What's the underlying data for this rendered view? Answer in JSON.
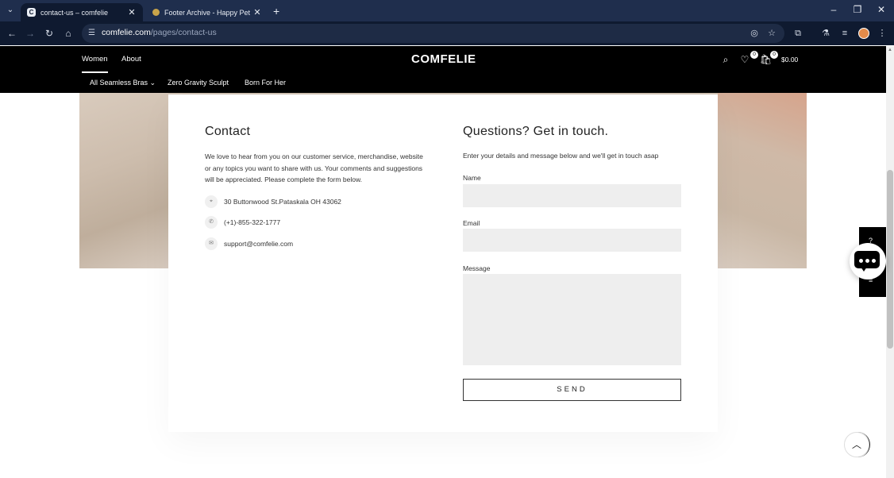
{
  "browser": {
    "tabs": [
      {
        "title": "contact-us – comfelie",
        "favicon": "C",
        "active": true
      },
      {
        "title": "Footer Archive - Happy Pet",
        "favicon": "",
        "active": false
      }
    ],
    "new_tab_icon": "+",
    "window_controls": {
      "minimize": "–",
      "restore": "❐",
      "close": "✕"
    },
    "url_host": "comfelie.com",
    "url_path": "/pages/contact-us",
    "icons": {
      "back": "←",
      "forward": "→",
      "reload": "↻",
      "home": "⌂",
      "site_info": "☰",
      "hide": "◎",
      "bookmark": "☆",
      "extensions": "⧉",
      "labs": "⚗",
      "media": "≡",
      "menu": "⋮"
    }
  },
  "site": {
    "brand": "COMFELIE",
    "top_nav": [
      "Women",
      "About"
    ],
    "sub_nav": [
      "All Seamless Bras",
      "Zero Gravity Sculpt",
      "Born For Her"
    ],
    "sub_nav_caret": "⌄",
    "wishlist_count": "0",
    "cart_count": "0",
    "cart_total": "$0.00",
    "icons": {
      "search": "⌕",
      "wishlist": "♡",
      "cart": "🛍"
    }
  },
  "contact": {
    "title": "Contact",
    "text": "We love to hear from you on our customer service, merchandise, website or any topics you want to share with us. Your comments and suggestions will be appreciated. Please complete the form below.",
    "address": "30 Buttonwood St.Pataskala OH 43062",
    "phone": "(+1)-855-322-1777",
    "email": "support@comfelie.com",
    "icons": {
      "address": "⌖",
      "phone": "✆",
      "email": "✉"
    }
  },
  "form": {
    "title": "Questions? Get in touch.",
    "subtitle": "Enter your details and message below and we'll get in touch asap",
    "name_label": "Name",
    "email_label": "Email",
    "message_label": "Message",
    "name_value": "",
    "email_value": "",
    "message_value": "",
    "send_label": "SEND"
  },
  "widgets": {
    "scroll_top_icon": "︿"
  }
}
